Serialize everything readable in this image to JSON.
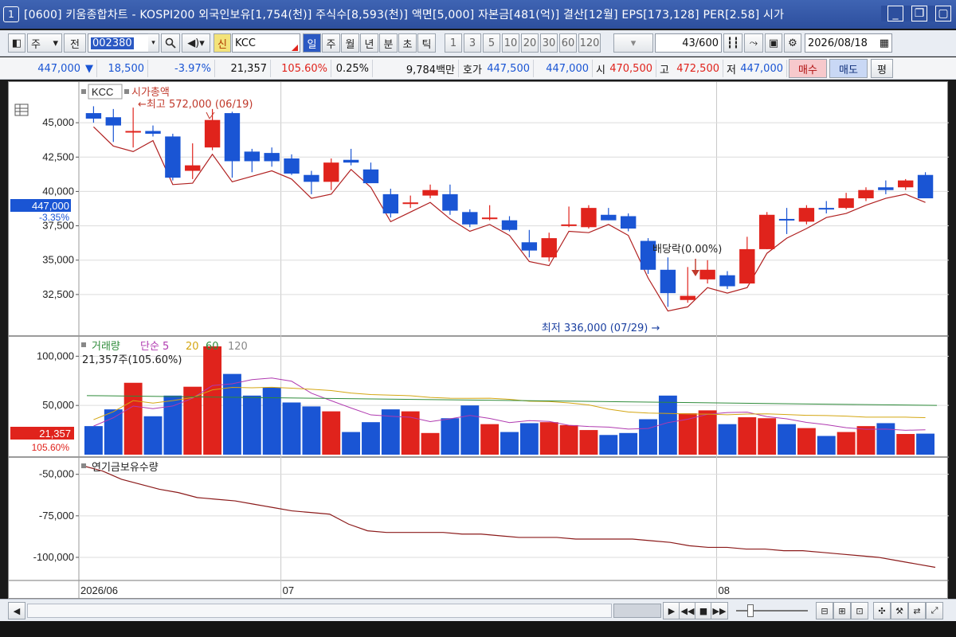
{
  "window": {
    "number": "1",
    "title": "[0600] 키움종합차트 - KOSPI200 외국인보유[1,754(천)] 주식수[8,593(천)] 액면[5,000] 자본금[481(억)] 결산[12월] EPS[173,128] PER[2.58] 시가"
  },
  "toolbar": {
    "market": "주",
    "prev_label": "전",
    "code": "002380",
    "credit_badge": "신",
    "stock_name": "KCC",
    "periods": [
      "일",
      "주",
      "월",
      "년",
      "분",
      "초",
      "틱"
    ],
    "active_period": "일",
    "intervals": [
      "1",
      "3",
      "5",
      "10",
      "20",
      "30",
      "60",
      "120"
    ],
    "count": "43",
    "count_total": "/600",
    "date": "2026/08/18"
  },
  "quote": {
    "price": "447,000",
    "change": "18,500",
    "change_pct": "-3.97%",
    "volume": "21,357",
    "volume_ratio": "105.60%",
    "turnover": "0.25%",
    "amount": "9,784백만",
    "ask_label": "호가",
    "ask": "447,500",
    "bid": "447,000",
    "open_label": "시",
    "open": "470,500",
    "high_label": "고",
    "high": "472,500",
    "low_label": "저",
    "low": "447,000",
    "buy_label": "매수",
    "sell_label": "매도",
    "eval_label": "평"
  },
  "price_panel": {
    "legend_name": "KCC",
    "legend_indicator": "시가총액",
    "y_ticks": [
      "45,000",
      "42,500",
      "40,000",
      "37,500",
      "35,000",
      "32,500"
    ],
    "current_tag": "447,000",
    "current_pct": "-3.35%",
    "high_note": "최고 572,000 (06/19)",
    "low_note": "최저 336,000 (07/29)",
    "dividend_note": "배당락(0.00%)"
  },
  "volume_panel": {
    "legend_title": "거래량",
    "ma_label": "단순",
    "ma_periods": [
      "5",
      "20",
      "60",
      "120"
    ],
    "subtitle": "21,357주(105.60%)",
    "y_ticks": [
      "100,000",
      "50,000"
    ],
    "current_tag": "21,357",
    "current_pct": "105.60%"
  },
  "pension_panel": {
    "legend_title": "연기금보유수량",
    "y_ticks": [
      "-50,000",
      "-75,000",
      "-100,000"
    ]
  },
  "x_axis": {
    "labels": [
      "2026/06",
      "07",
      "08"
    ]
  },
  "chart_data": {
    "type": "candlestick",
    "categories": [
      "06/01",
      "06/02",
      "06/03",
      "06/04",
      "06/05",
      "06/08",
      "06/09",
      "06/10",
      "06/11",
      "06/12",
      "06/15",
      "06/16",
      "06/17",
      "06/18",
      "06/19",
      "06/22",
      "06/23",
      "06/24",
      "06/25",
      "06/26",
      "06/29",
      "06/30",
      "07/01",
      "07/02",
      "07/03",
      "07/06",
      "07/07",
      "07/08",
      "07/09",
      "07/10",
      "07/13",
      "07/14",
      "07/15",
      "07/16",
      "07/17",
      "07/20",
      "07/21",
      "07/22",
      "07/23",
      "07/24",
      "07/27",
      "07/28",
      "07/29",
      "07/30",
      "07/31",
      "08/03",
      "08/04",
      "08/05",
      "08/06",
      "08/07",
      "08/10",
      "08/11",
      "08/12",
      "08/13",
      "08/14",
      "08/17",
      "08/18"
    ],
    "candles": [
      {
        "o": 45700,
        "h": 46200,
        "l": 45000,
        "c": 45300,
        "dir": "down"
      },
      {
        "o": 45400,
        "h": 46000,
        "l": 43600,
        "c": 44800,
        "dir": "down"
      },
      {
        "o": 44300,
        "h": 46100,
        "l": 43200,
        "c": 44400,
        "dir": "up"
      },
      {
        "o": 44400,
        "h": 44800,
        "l": 44000,
        "c": 44200,
        "dir": "down"
      },
      {
        "o": 44000,
        "h": 44200,
        "l": 40800,
        "c": 41000,
        "dir": "down"
      },
      {
        "o": 41500,
        "h": 43500,
        "l": 40900,
        "c": 41900,
        "dir": "up"
      },
      {
        "o": 43200,
        "h": 46000,
        "l": 43000,
        "c": 45200,
        "dir": "up"
      },
      {
        "o": 45700,
        "h": 45800,
        "l": 41000,
        "c": 42200,
        "dir": "down"
      },
      {
        "o": 42900,
        "h": 43100,
        "l": 41400,
        "c": 42200,
        "dir": "down"
      },
      {
        "o": 42800,
        "h": 43200,
        "l": 41800,
        "c": 42200,
        "dir": "down"
      },
      {
        "o": 42400,
        "h": 42700,
        "l": 41200,
        "c": 41300,
        "dir": "down"
      },
      {
        "o": 41200,
        "h": 41500,
        "l": 39800,
        "c": 40700,
        "dir": "down"
      },
      {
        "o": 40700,
        "h": 42400,
        "l": 40100,
        "c": 42100,
        "dir": "up"
      },
      {
        "o": 42300,
        "h": 43100,
        "l": 41900,
        "c": 42100,
        "dir": "down"
      },
      {
        "o": 41600,
        "h": 42100,
        "l": 40600,
        "c": 40600,
        "dir": "down"
      },
      {
        "o": 39800,
        "h": 40200,
        "l": 38100,
        "c": 38400,
        "dir": "down"
      },
      {
        "o": 39200,
        "h": 39700,
        "l": 38800,
        "c": 39200,
        "dir": "up"
      },
      {
        "o": 39700,
        "h": 40500,
        "l": 39500,
        "c": 40100,
        "dir": "up"
      },
      {
        "o": 39800,
        "h": 40500,
        "l": 38300,
        "c": 38600,
        "dir": "down"
      },
      {
        "o": 38500,
        "h": 38700,
        "l": 37400,
        "c": 37600,
        "dir": "down"
      },
      {
        "o": 38100,
        "h": 39000,
        "l": 37900,
        "c": 38100,
        "dir": "up"
      },
      {
        "o": 37900,
        "h": 38200,
        "l": 37100,
        "c": 37200,
        "dir": "down"
      },
      {
        "o": 36300,
        "h": 37200,
        "l": 35200,
        "c": 35700,
        "dir": "down"
      },
      {
        "o": 35200,
        "h": 37000,
        "l": 34900,
        "c": 36600,
        "dir": "up"
      },
      {
        "o": 37600,
        "h": 38900,
        "l": 37400,
        "c": 37600,
        "dir": "up"
      },
      {
        "o": 37400,
        "h": 39000,
        "l": 37300,
        "c": 38800,
        "dir": "up"
      },
      {
        "o": 38300,
        "h": 38800,
        "l": 37900,
        "c": 37900,
        "dir": "down"
      },
      {
        "o": 38200,
        "h": 38400,
        "l": 37100,
        "c": 37300,
        "dir": "down"
      },
      {
        "o": 36400,
        "h": 36600,
        "l": 34000,
        "c": 34300,
        "dir": "down"
      },
      {
        "o": 34300,
        "h": 35200,
        "l": 31600,
        "c": 32600,
        "dir": "down"
      },
      {
        "o": 32100,
        "h": 34500,
        "l": 31900,
        "c": 32400,
        "dir": "up"
      },
      {
        "o": 33600,
        "h": 35000,
        "l": 33300,
        "c": 34300,
        "dir": "up"
      },
      {
        "o": 33900,
        "h": 34200,
        "l": 32900,
        "c": 33100,
        "dir": "down"
      },
      {
        "o": 33300,
        "h": 36700,
        "l": 33300,
        "c": 35800,
        "dir": "up"
      },
      {
        "o": 35800,
        "h": 38500,
        "l": 35800,
        "c": 38300,
        "dir": "up"
      },
      {
        "o": 38000,
        "h": 38800,
        "l": 36900,
        "c": 38000,
        "dir": "down"
      },
      {
        "o": 37800,
        "h": 39000,
        "l": 37600,
        "c": 38800,
        "dir": "up"
      },
      {
        "o": 38800,
        "h": 39300,
        "l": 38400,
        "c": 38800,
        "dir": "down"
      },
      {
        "o": 38800,
        "h": 39900,
        "l": 38700,
        "c": 39500,
        "dir": "up"
      },
      {
        "o": 39500,
        "h": 40300,
        "l": 39300,
        "c": 40100,
        "dir": "up"
      },
      {
        "o": 40100,
        "h": 40800,
        "l": 39800,
        "c": 40300,
        "dir": "down"
      },
      {
        "o": 40300,
        "h": 40900,
        "l": 40100,
        "c": 40800,
        "dir": "up"
      },
      {
        "o": 41200,
        "h": 41400,
        "l": 39800,
        "c": 39500,
        "dir": "down"
      }
    ],
    "volume": [
      29000,
      46000,
      73000,
      39000,
      60000,
      69000,
      110000,
      82000,
      60000,
      68000,
      53000,
      49000,
      44000,
      23000,
      33000,
      46000,
      44000,
      22000,
      37000,
      50000,
      31000,
      23000,
      32000,
      33000,
      30000,
      25000,
      20000,
      22000,
      36000,
      60000,
      42000,
      45000,
      31000,
      38000,
      37000,
      31000,
      27000,
      19000,
      23000,
      29000,
      32000,
      21000,
      21357
    ],
    "pension": [
      -45000,
      -48000,
      -53000,
      -56000,
      -59000,
      -61000,
      -64000,
      -65000,
      -66000,
      -68000,
      -70000,
      -72000,
      -73000,
      -74000,
      -80000,
      -84000,
      -85000,
      -85000,
      -85000,
      -85000,
      -86000,
      -86000,
      -87000,
      -88000,
      -88000,
      -88000,
      -89000,
      -89000,
      -89000,
      -89000,
      -90000,
      -91000,
      -93000,
      -94000,
      -94000,
      -95000,
      -95000,
      -96000,
      -96000,
      -97000,
      -98000,
      -99000,
      -100000,
      -102000,
      -104000,
      -106000
    ],
    "y_range": [
      30000,
      47500
    ],
    "volume_range": [
      0,
      110000
    ],
    "pension_range": [
      -112000,
      -42000
    ],
    "colors": {
      "up": "#e0231c",
      "down": "#1a55d4",
      "ma5": "#b03ab0",
      "ma20": "#d4a612",
      "ma60": "#2e8b3a",
      "ma120": "#888888",
      "price_line": "#b02020",
      "pension": "#8b1a1a"
    }
  }
}
